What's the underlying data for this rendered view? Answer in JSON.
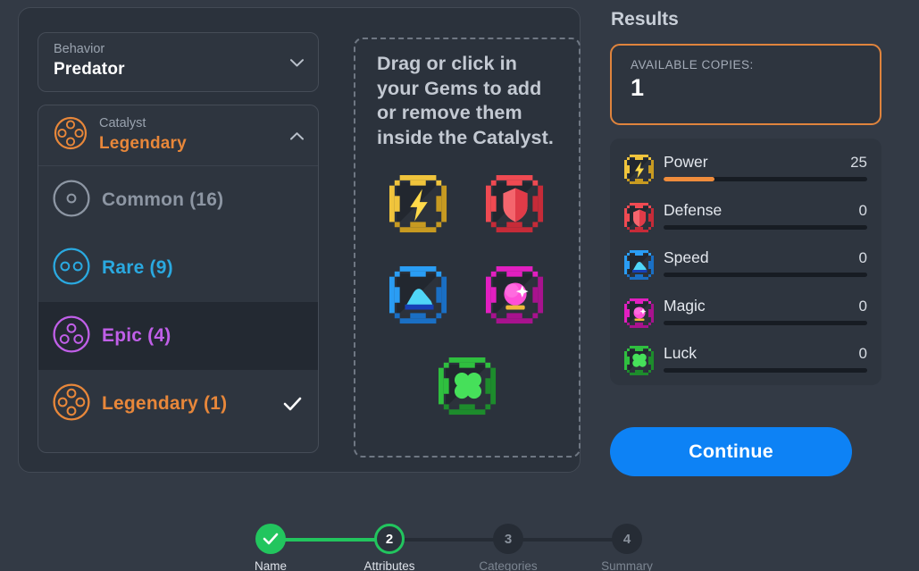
{
  "behavior_select": {
    "name": "behavior-select",
    "label": "Behavior",
    "value": "Predator",
    "chevron": "chevron-down-icon"
  },
  "catalyst": {
    "label": "Catalyst",
    "value": "Legendary",
    "value_color": "#e8873a",
    "chevron": "chevron-up-icon",
    "icon": "rarity-legendary-icon",
    "options": [
      {
        "label": "Common (16)",
        "name": "Common",
        "count": 16,
        "color": "#8d96a3",
        "dots": 1,
        "selected": false,
        "highlighted": false
      },
      {
        "label": "Rare (9)",
        "name": "Rare",
        "count": 9,
        "color": "#2aa9e0",
        "dots": 2,
        "selected": false,
        "highlighted": false
      },
      {
        "label": "Epic (4)",
        "name": "Epic",
        "count": 4,
        "color": "#c05fe8",
        "dots": 3,
        "selected": false,
        "highlighted": true
      },
      {
        "label": "Legendary (1)",
        "name": "Legendary",
        "count": 1,
        "color": "#e8873a",
        "dots": 4,
        "selected": true,
        "highlighted": false
      }
    ]
  },
  "dropzone": {
    "instructions": "Drag or click in your Gems to add or remove them inside the Catalyst.",
    "gems": [
      {
        "name": "power-gem",
        "label": "Power",
        "icon": "lightning-bolt-icon",
        "color": "#f0c43c",
        "dark": "#c79a21"
      },
      {
        "name": "defense-gem",
        "label": "Defense",
        "icon": "shield-icon",
        "color": "#ef4a52",
        "dark": "#c62b38"
      },
      {
        "name": "speed-gem",
        "label": "Speed",
        "icon": "shoe-icon",
        "color": "#2a9df4",
        "dark": "#1a6fc4"
      },
      {
        "name": "magic-gem",
        "label": "Magic",
        "icon": "crystal-ball-icon",
        "color": "#e21fc0",
        "dark": "#a8128e"
      },
      {
        "name": "luck-gem",
        "label": "Luck",
        "icon": "clover-icon",
        "color": "#2fbf3f",
        "dark": "#1d8c2c"
      }
    ]
  },
  "results": {
    "title": "Results",
    "available_copies_label": "AVAILABLE COPIES:",
    "available_copies_value": "1",
    "border_color": "#e0843d",
    "stats": [
      {
        "label": "Power",
        "value": "25",
        "pct": 25,
        "fill": "#ef8c3c",
        "icon": "lightning-bolt-icon",
        "color": "#f0c43c",
        "dark": "#c79a21"
      },
      {
        "label": "Defense",
        "value": "0",
        "pct": 0,
        "fill": "#ef8c3c",
        "icon": "shield-icon",
        "color": "#ef4a52",
        "dark": "#c62b38"
      },
      {
        "label": "Speed",
        "value": "0",
        "pct": 0,
        "fill": "#ef8c3c",
        "icon": "shoe-icon",
        "color": "#2a9df4",
        "dark": "#1a6fc4"
      },
      {
        "label": "Magic",
        "value": "0",
        "pct": 0,
        "fill": "#ef8c3c",
        "icon": "crystal-ball-icon",
        "color": "#e21fc0",
        "dark": "#a8128e"
      },
      {
        "label": "Luck",
        "value": "0",
        "pct": 0,
        "fill": "#ef8c3c",
        "icon": "clover-icon",
        "color": "#2fbf3f",
        "dark": "#1d8c2c"
      }
    ]
  },
  "continue_button": {
    "label": "Continue",
    "color": "#0d82f5"
  },
  "stepper": {
    "accent": "#22c55e",
    "steps": [
      {
        "label": "Name",
        "number": "1",
        "state": "done"
      },
      {
        "label": "Attributes",
        "number": "2",
        "state": "current"
      },
      {
        "label": "Categories",
        "number": "3",
        "state": "todo"
      },
      {
        "label": "Summary",
        "number": "4",
        "state": "todo"
      }
    ]
  }
}
